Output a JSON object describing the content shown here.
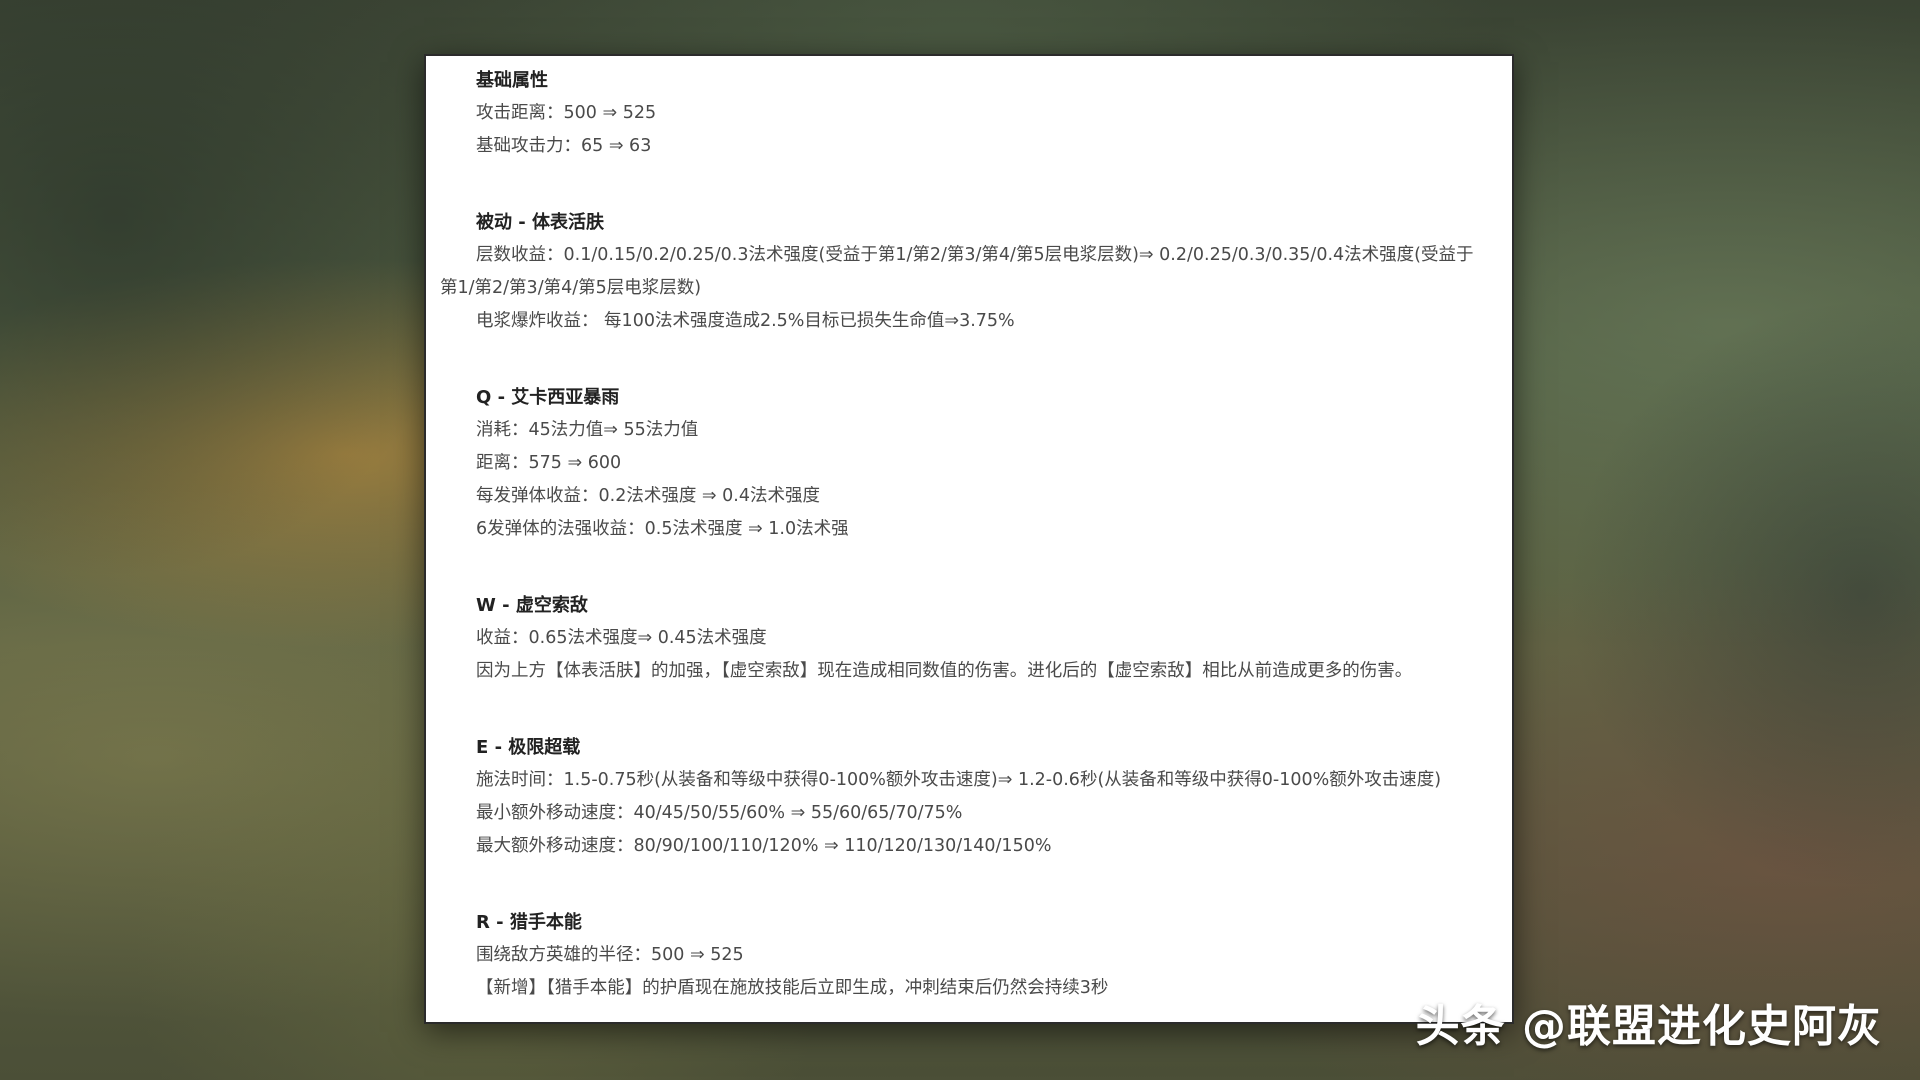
{
  "sections": [
    {
      "title": "基础属性",
      "lines": [
        "攻击距离：500 ⇒ 525",
        "基础攻击力：65 ⇒ 63"
      ]
    },
    {
      "title": "被动 - 体表活肤",
      "lines": [
        "层数收益：0.1/0.15/0.2/0.25/0.3法术强度(受益于第1/第2/第3/第4/第5层电浆层数)⇒ 0.2/0.25/0.3/0.35/0.4法术强度(受益于第1/第2/第3/第4/第5层电浆层数)",
        "电浆爆炸收益： 每100法术强度造成2.5%目标已损失生命值⇒3.75%"
      ]
    },
    {
      "title": "Q - 艾卡西亚暴雨",
      "lines": [
        "消耗：45法力值⇒ 55法力值",
        "距离：575 ⇒ 600",
        "每发弹体收益：0.2法术强度 ⇒ 0.4法术强度",
        "6发弹体的法强收益：0.5法术强度 ⇒ 1.0法术强"
      ]
    },
    {
      "title": "W - 虚空索敌",
      "lines": [
        "收益：0.65法术强度⇒ 0.45法术强度",
        "因为上方【体表活肤】的加强，【虚空索敌】现在造成相同数值的伤害。进化后的【虚空索敌】相比从前造成更多的伤害。"
      ]
    },
    {
      "title": "E - 极限超载",
      "lines": [
        "施法时间：1.5-0.75秒(从装备和等级中获得0-100%额外攻击速度)⇒ 1.2-0.6秒(从装备和等级中获得0-100%额外攻击速度)",
        "最小额外移动速度：40/45/50/55/60% ⇒ 55/60/65/70/75%",
        "最大额外移动速度：80/90/100/110/120% ⇒ 110/120/130/140/150%"
      ]
    },
    {
      "title": "R - 猎手本能",
      "lines": [
        "围绕敌方英雄的半径：500 ⇒ 525",
        "【新增】【猎手本能】的护盾现在施放技能后立即生成，冲刺结束后仍然会持续3秒"
      ]
    }
  ],
  "watermark": "头条 @联盟进化史阿灰"
}
